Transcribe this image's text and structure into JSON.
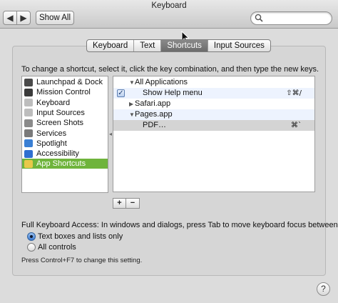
{
  "window": {
    "title": "Keyboard",
    "back_glyph": "◀",
    "forward_glyph": "▶",
    "show_all_label": "Show All",
    "search": {
      "value": "",
      "placeholder": ""
    }
  },
  "tabs": [
    {
      "label": "Keyboard",
      "selected": false
    },
    {
      "label": "Text",
      "selected": false
    },
    {
      "label": "Shortcuts",
      "selected": true
    },
    {
      "label": "Input Sources",
      "selected": false
    }
  ],
  "instruction": "To change a shortcut, select it, click the key combination, and then type the new keys.",
  "categories": [
    {
      "label": "Launchpad & Dock",
      "icon": "launchpad-dock-icon",
      "color": "#4a4a4a",
      "selected": false
    },
    {
      "label": "Mission Control",
      "icon": "mission-control-icon",
      "color": "#3a3a3a",
      "selected": false
    },
    {
      "label": "Keyboard",
      "icon": "keyboard-icon",
      "color": "#bdbdbd",
      "selected": false
    },
    {
      "label": "Input Sources",
      "icon": "input-sources-icon",
      "color": "#bdbdbd",
      "selected": false
    },
    {
      "label": "Screen Shots",
      "icon": "screen-shots-icon",
      "color": "#8a8a8a",
      "selected": false
    },
    {
      "label": "Services",
      "icon": "services-gear-icon",
      "color": "#7a7a7a",
      "selected": false
    },
    {
      "label": "Spotlight",
      "icon": "spotlight-icon",
      "color": "#3a7fd4",
      "selected": false
    },
    {
      "label": "Accessibility",
      "icon": "accessibility-icon",
      "color": "#2f6fd0",
      "selected": false
    },
    {
      "label": "App Shortcuts",
      "icon": "app-shortcuts-icon",
      "color": "#e8c84a",
      "selected": true
    }
  ],
  "shortcuts": [
    {
      "label": "All Applications",
      "disclosure": "▼",
      "key": "",
      "checked": false,
      "level": 0,
      "selected": false
    },
    {
      "label": "Show Help menu",
      "disclosure": "",
      "key": "⇧⌘/",
      "checked": true,
      "level": 1,
      "selected": false
    },
    {
      "label": "Safari.app",
      "disclosure": "▶",
      "key": "",
      "checked": false,
      "level": 0,
      "selected": false
    },
    {
      "label": "Pages.app",
      "disclosure": "▼",
      "key": "",
      "checked": false,
      "level": 0,
      "selected": false
    },
    {
      "label": "PDF…",
      "disclosure": "",
      "key": "⌘`",
      "checked": false,
      "level": 1,
      "selected": true
    }
  ],
  "add_remove": {
    "add": "+",
    "remove": "−"
  },
  "full_keyboard_access": {
    "label": "Full Keyboard Access: In windows and dialogs, press Tab to move keyboard focus between:",
    "options": [
      {
        "label": "Text boxes and lists only",
        "selected": true
      },
      {
        "label": "All controls",
        "selected": false
      }
    ],
    "hint": "Press Control+F7 to change this setting."
  },
  "help_label": "?",
  "colors": {
    "selection_green": "#6fb43c",
    "selected_row_gray": "#d4d4d4",
    "alt_row_blue": "#edf3fe"
  }
}
